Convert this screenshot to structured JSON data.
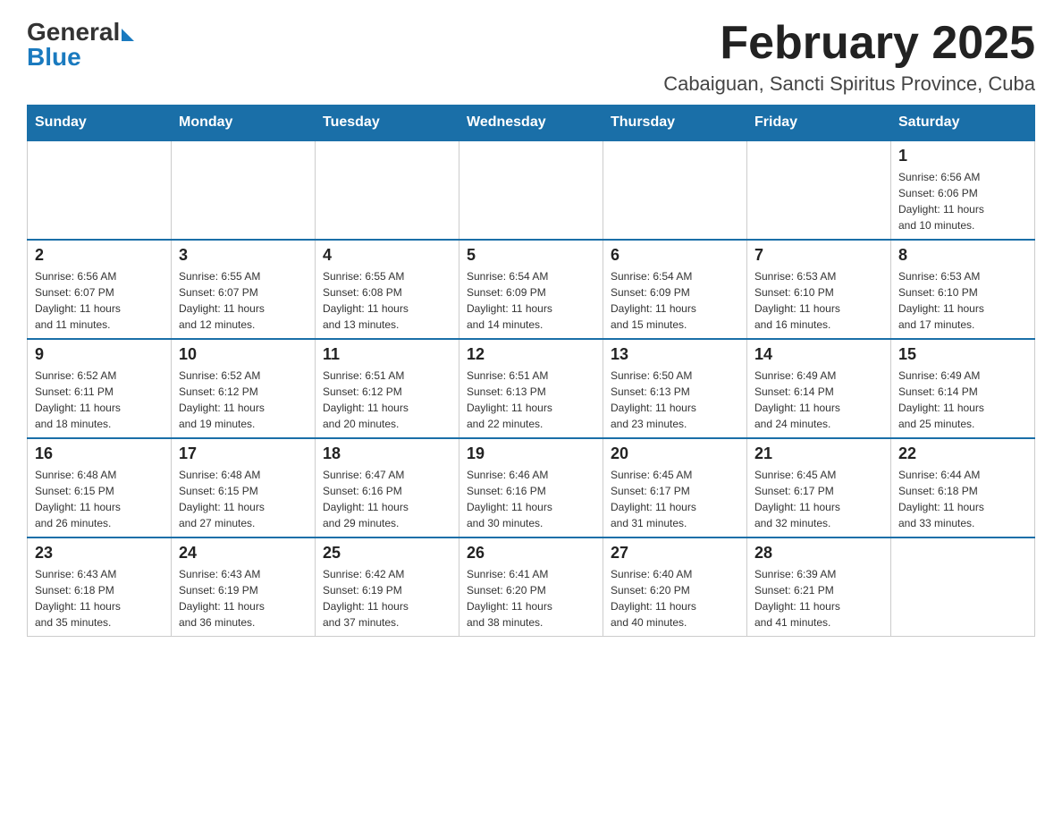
{
  "header": {
    "logo_general": "General",
    "logo_blue": "Blue",
    "title": "February 2025",
    "subtitle": "Cabaiguan, Sancti Spiritus Province, Cuba"
  },
  "days_of_week": [
    "Sunday",
    "Monday",
    "Tuesday",
    "Wednesday",
    "Thursday",
    "Friday",
    "Saturday"
  ],
  "weeks": [
    [
      {
        "day": "",
        "info": ""
      },
      {
        "day": "",
        "info": ""
      },
      {
        "day": "",
        "info": ""
      },
      {
        "day": "",
        "info": ""
      },
      {
        "day": "",
        "info": ""
      },
      {
        "day": "",
        "info": ""
      },
      {
        "day": "1",
        "info": "Sunrise: 6:56 AM\nSunset: 6:06 PM\nDaylight: 11 hours\nand 10 minutes."
      }
    ],
    [
      {
        "day": "2",
        "info": "Sunrise: 6:56 AM\nSunset: 6:07 PM\nDaylight: 11 hours\nand 11 minutes."
      },
      {
        "day": "3",
        "info": "Sunrise: 6:55 AM\nSunset: 6:07 PM\nDaylight: 11 hours\nand 12 minutes."
      },
      {
        "day": "4",
        "info": "Sunrise: 6:55 AM\nSunset: 6:08 PM\nDaylight: 11 hours\nand 13 minutes."
      },
      {
        "day": "5",
        "info": "Sunrise: 6:54 AM\nSunset: 6:09 PM\nDaylight: 11 hours\nand 14 minutes."
      },
      {
        "day": "6",
        "info": "Sunrise: 6:54 AM\nSunset: 6:09 PM\nDaylight: 11 hours\nand 15 minutes."
      },
      {
        "day": "7",
        "info": "Sunrise: 6:53 AM\nSunset: 6:10 PM\nDaylight: 11 hours\nand 16 minutes."
      },
      {
        "day": "8",
        "info": "Sunrise: 6:53 AM\nSunset: 6:10 PM\nDaylight: 11 hours\nand 17 minutes."
      }
    ],
    [
      {
        "day": "9",
        "info": "Sunrise: 6:52 AM\nSunset: 6:11 PM\nDaylight: 11 hours\nand 18 minutes."
      },
      {
        "day": "10",
        "info": "Sunrise: 6:52 AM\nSunset: 6:12 PM\nDaylight: 11 hours\nand 19 minutes."
      },
      {
        "day": "11",
        "info": "Sunrise: 6:51 AM\nSunset: 6:12 PM\nDaylight: 11 hours\nand 20 minutes."
      },
      {
        "day": "12",
        "info": "Sunrise: 6:51 AM\nSunset: 6:13 PM\nDaylight: 11 hours\nand 22 minutes."
      },
      {
        "day": "13",
        "info": "Sunrise: 6:50 AM\nSunset: 6:13 PM\nDaylight: 11 hours\nand 23 minutes."
      },
      {
        "day": "14",
        "info": "Sunrise: 6:49 AM\nSunset: 6:14 PM\nDaylight: 11 hours\nand 24 minutes."
      },
      {
        "day": "15",
        "info": "Sunrise: 6:49 AM\nSunset: 6:14 PM\nDaylight: 11 hours\nand 25 minutes."
      }
    ],
    [
      {
        "day": "16",
        "info": "Sunrise: 6:48 AM\nSunset: 6:15 PM\nDaylight: 11 hours\nand 26 minutes."
      },
      {
        "day": "17",
        "info": "Sunrise: 6:48 AM\nSunset: 6:15 PM\nDaylight: 11 hours\nand 27 minutes."
      },
      {
        "day": "18",
        "info": "Sunrise: 6:47 AM\nSunset: 6:16 PM\nDaylight: 11 hours\nand 29 minutes."
      },
      {
        "day": "19",
        "info": "Sunrise: 6:46 AM\nSunset: 6:16 PM\nDaylight: 11 hours\nand 30 minutes."
      },
      {
        "day": "20",
        "info": "Sunrise: 6:45 AM\nSunset: 6:17 PM\nDaylight: 11 hours\nand 31 minutes."
      },
      {
        "day": "21",
        "info": "Sunrise: 6:45 AM\nSunset: 6:17 PM\nDaylight: 11 hours\nand 32 minutes."
      },
      {
        "day": "22",
        "info": "Sunrise: 6:44 AM\nSunset: 6:18 PM\nDaylight: 11 hours\nand 33 minutes."
      }
    ],
    [
      {
        "day": "23",
        "info": "Sunrise: 6:43 AM\nSunset: 6:18 PM\nDaylight: 11 hours\nand 35 minutes."
      },
      {
        "day": "24",
        "info": "Sunrise: 6:43 AM\nSunset: 6:19 PM\nDaylight: 11 hours\nand 36 minutes."
      },
      {
        "day": "25",
        "info": "Sunrise: 6:42 AM\nSunset: 6:19 PM\nDaylight: 11 hours\nand 37 minutes."
      },
      {
        "day": "26",
        "info": "Sunrise: 6:41 AM\nSunset: 6:20 PM\nDaylight: 11 hours\nand 38 minutes."
      },
      {
        "day": "27",
        "info": "Sunrise: 6:40 AM\nSunset: 6:20 PM\nDaylight: 11 hours\nand 40 minutes."
      },
      {
        "day": "28",
        "info": "Sunrise: 6:39 AM\nSunset: 6:21 PM\nDaylight: 11 hours\nand 41 minutes."
      },
      {
        "day": "",
        "info": ""
      }
    ]
  ]
}
